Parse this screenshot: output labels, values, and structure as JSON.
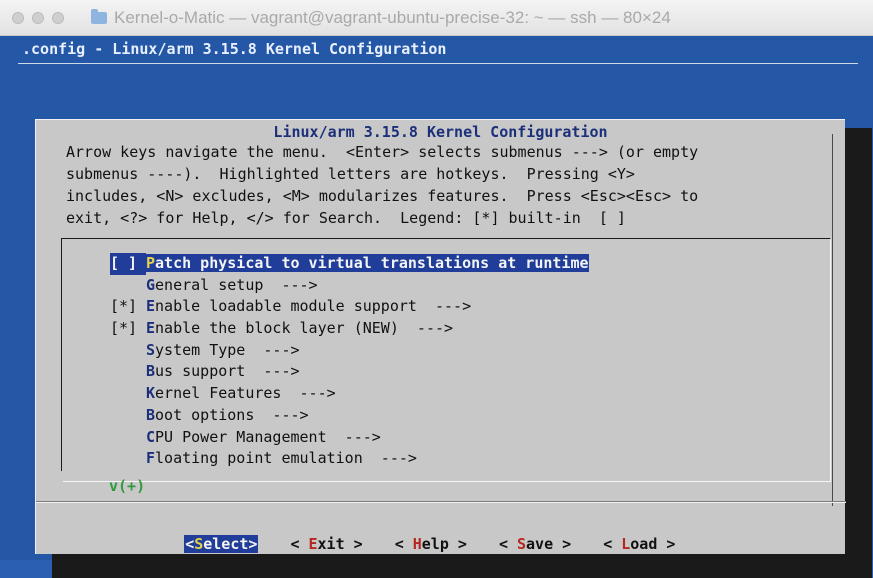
{
  "window": {
    "title": "Kernel-o-Matic — vagrant@vagrant-ubuntu-precise-32: ~ — ssh — 80×24",
    "folder_icon": "folder-icon"
  },
  "terminal": {
    "backtitle": ".config - Linux/arm 3.15.8 Kernel Configuration"
  },
  "dialog": {
    "title": "Linux/arm 3.15.8 Kernel Configuration",
    "help_lines": [
      "Arrow keys navigate the menu.  <Enter> selects submenus ---> (or empty",
      "submenus ----).  Highlighted letters are hotkeys.  Pressing <Y>",
      "includes, <N> excludes, <M> modularizes features.  Press <Esc><Esc> to",
      "exit, <?> for Help, </> for Search.  Legend: [*] built-in  [ ]"
    ],
    "more_indicator": "v(+)"
  },
  "menu": {
    "items": [
      {
        "mark": "[ ]",
        "hot": "P",
        "rest": "atch physical to virtual translations at runtime",
        "selected": true
      },
      {
        "mark": "",
        "hot": "G",
        "rest": "eneral setup  --->",
        "selected": false
      },
      {
        "mark": "[*]",
        "hot": "E",
        "rest": "nable loadable module support  --->",
        "selected": false
      },
      {
        "mark": "[*]",
        "hot": "E",
        "rest": "nable the block layer (NEW)  --->",
        "selected": false
      },
      {
        "mark": "",
        "hot": "S",
        "rest": "ystem Type  --->",
        "selected": false
      },
      {
        "mark": "",
        "hot": "B",
        "rest": "us support  --->",
        "selected": false
      },
      {
        "mark": "",
        "hot": "K",
        "rest": "ernel Features  --->",
        "selected": false
      },
      {
        "mark": "",
        "hot": "B",
        "rest": "oot options  --->",
        "selected": false
      },
      {
        "mark": "",
        "hot": "C",
        "rest": "PU Power Management  --->",
        "selected": false
      },
      {
        "mark": "",
        "hot": "F",
        "rest": "loating point emulation  --->",
        "selected": false
      }
    ]
  },
  "buttons": {
    "select": {
      "pre": "<",
      "hot": "S",
      "post": "elect>"
    },
    "exit": {
      "pre": "< ",
      "hot": "E",
      "post": "xit >"
    },
    "help": {
      "pre": "< ",
      "hot": "H",
      "post": "elp >"
    },
    "save": {
      "pre": "< ",
      "hot": "S",
      "post": "ave >"
    },
    "load": {
      "pre": "< ",
      "hot": "L",
      "post": "oad >"
    }
  },
  "colors": {
    "terminal_bg": "#2457a6",
    "dialog_bg": "#c8c8c8",
    "highlight_bg": "#1f3d99",
    "hotkey_text": "#1c2f7a",
    "hotkey_selected": "#e5d24a",
    "button_hotkey": "#b5281f"
  }
}
